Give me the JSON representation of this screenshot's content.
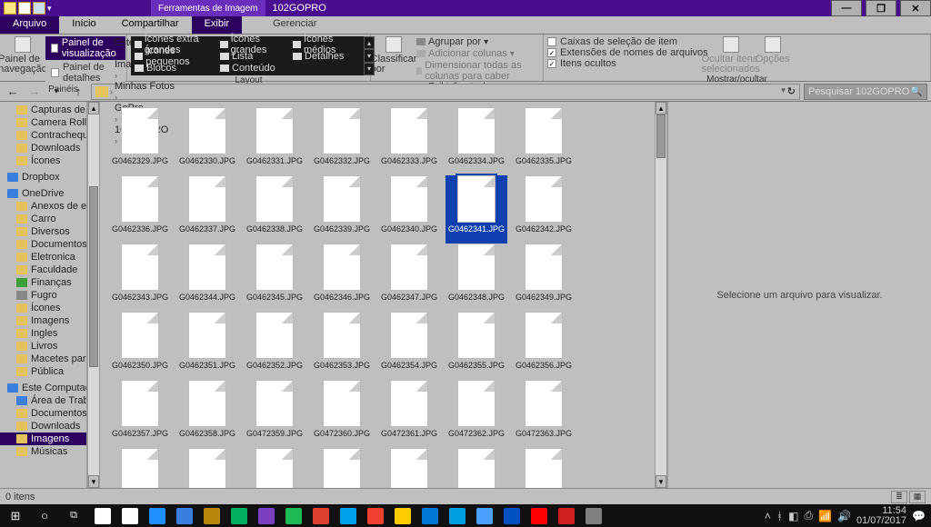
{
  "title": {
    "tool_tab": "Ferramentas de Imagem",
    "window": "102GOPRO"
  },
  "win_controls": {
    "min": "—",
    "max": "❐",
    "close": "✕"
  },
  "menu_tabs": {
    "file": "Arquivo",
    "home": "Início",
    "share": "Compartilhar",
    "view": "Exibir",
    "manage": "Gerenciar"
  },
  "ribbon": {
    "panels": {
      "nav": "Painel de navegação",
      "preview": "Painel de visualização",
      "details": "Painel de detalhes",
      "group": "Painéis"
    },
    "layout": {
      "items": [
        "Ícones extra grandes",
        "Ícones grandes",
        "Ícones médios",
        "Ícones pequenos",
        "Lista",
        "Detalhes",
        "Blocos",
        "Conteúdo"
      ],
      "group": "Layout"
    },
    "current": {
      "sort": "Classificar por",
      "group": "Agrupar por",
      "addcols": "Adicionar colunas",
      "sizecols": "Dimensionar todas as colunas para caber",
      "label": "Exibição atual"
    },
    "showhide": {
      "chk1": "Caixas de seleção de item",
      "chk2": "Extensões de nomes de arquivos",
      "chk3": "Itens ocultos",
      "hidden_btn": "Ocultar itens selecionados",
      "options": "Opções",
      "label": "Mostrar/ocultar"
    }
  },
  "breadcrumb": {
    "parts": [
      "Este Computador",
      "Imagens",
      "Minhas Fotos",
      "GoPro",
      "102GOPRO"
    ]
  },
  "search_placeholder": "Pesquisar 102GOPRO",
  "tree": {
    "quick": [
      {
        "label": "Capturas de",
        "icon": "yellow"
      },
      {
        "label": "Camera Roll",
        "icon": "yellow"
      },
      {
        "label": "Contracheque",
        "icon": "yellow"
      },
      {
        "label": "Downloads",
        "icon": "yellow"
      },
      {
        "label": "Ícones",
        "icon": "yellow"
      }
    ],
    "dropbox": "Dropbox",
    "onedrive": "OneDrive",
    "onedrive_items": [
      "Anexos de email",
      "Carro",
      "Diversos",
      "Documentos",
      "Eletronica",
      "Faculdade",
      "Finanças",
      "Fugro",
      "Ícones",
      "Imagens",
      "Ingles",
      "Livros",
      "Macetes para S",
      "Pública"
    ],
    "thispc": "Este Computador",
    "thispc_items": [
      "Área de Trabalho",
      "Documentos",
      "Downloads",
      "Imagens",
      "Músicas"
    ]
  },
  "files": [
    "G0462329.JPG",
    "G0462330.JPG",
    "G0462331.JPG",
    "G0462332.JPG",
    "G0462333.JPG",
    "G0462334.JPG",
    "G0462335.JPG",
    "G0462336.JPG",
    "G0462337.JPG",
    "G0462338.JPG",
    "G0462339.JPG",
    "G0462340.JPG",
    "G0462341.JPG",
    "G0462342.JPG",
    "G0462343.JPG",
    "G0462344.JPG",
    "G0462345.JPG",
    "G0462346.JPG",
    "G0462347.JPG",
    "G0462348.JPG",
    "G0462349.JPG",
    "G0462350.JPG",
    "G0462351.JPG",
    "G0462352.JPG",
    "G0462353.JPG",
    "G0462354.JPG",
    "G0462355.JPG",
    "G0462356.JPG",
    "G0462357.JPG",
    "G0462358.JPG",
    "G0472359.JPG",
    "G0472360.JPG",
    "G0472361.JPG",
    "G0472362.JPG",
    "G0472363.JPG",
    "",
    "",
    "",
    "",
    "",
    "",
    ""
  ],
  "selected_file_index": 12,
  "preview_text": "Selecione um arquivo para visualizar.",
  "status": {
    "left": "0 itens"
  },
  "taskbar": {
    "apps_colors": [
      "#fff",
      "#fff",
      "#1e90ff",
      "#3a7fe0",
      "#b8860b",
      "#00b060",
      "#7b3fbf",
      "#1db954",
      "#e04030",
      "#00a2ed",
      "#f04030",
      "#ffcc00",
      "#0078d7",
      "#00a0e0",
      "#4aa0ff",
      "#0050c0",
      "#ff0000",
      "#d02020",
      "#808080"
    ],
    "time": "11:54",
    "date": "01/07/2017"
  }
}
